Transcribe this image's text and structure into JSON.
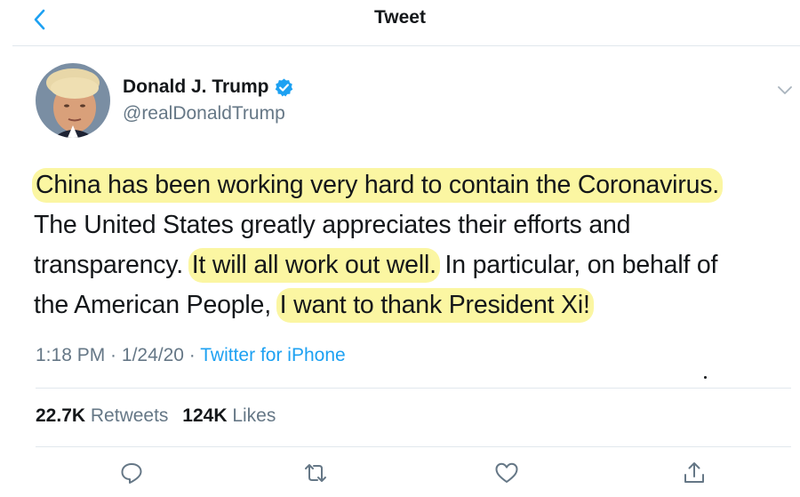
{
  "header": {
    "title": "Tweet",
    "back_icon": "chevron-left-icon"
  },
  "author": {
    "display_name": "Donald J. Trump",
    "handle": "@realDonaldTrump",
    "verified": true,
    "avatar_icon": "avatar"
  },
  "tweet": {
    "line1": {
      "hl": "China has been working very hard to contain the Coronavirus."
    },
    "line2": {
      "text": "The United States greatly appreciates their efforts and"
    },
    "line3": {
      "pre": "transparency.",
      "hl": "It will all work out well.",
      "post": "In particular, on behalf of"
    },
    "line4": {
      "pre": "the American People,",
      "hl": "I want to thank President Xi!"
    },
    "highlight_color": "#fbf6a2"
  },
  "meta": {
    "time": "1:18 PM",
    "sep1": " · ",
    "date": "1/24/20",
    "sep2": " · ",
    "source": "Twitter for iPhone"
  },
  "stats": {
    "retweets_count": "22.7K",
    "retweets_label": "Retweets",
    "likes_count": "124K",
    "likes_label": "Likes"
  },
  "actions": [
    "reply-icon",
    "retweet-icon",
    "like-icon",
    "share-icon"
  ],
  "colors": {
    "accent": "#1da1f2",
    "secondary_text": "#657786",
    "divider": "#e1e8ed"
  }
}
